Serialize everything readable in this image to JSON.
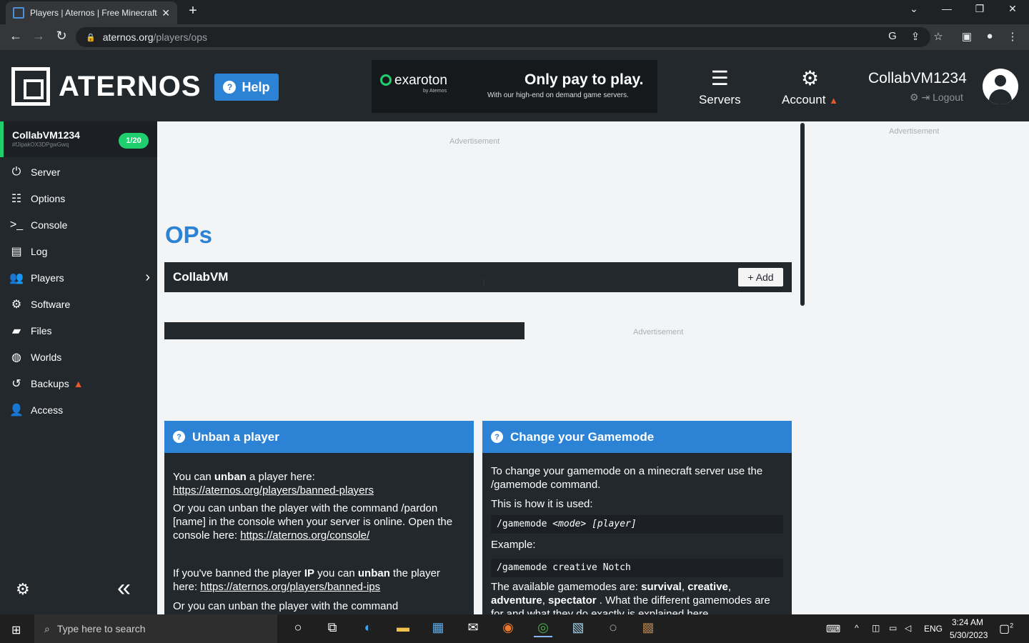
{
  "browser": {
    "tab_title": "Players | Aternos | Free Minecraft",
    "close_glyph": "✕",
    "new_tab_glyph": "+",
    "url_host": "aternos.org",
    "url_path": "/players/ops"
  },
  "header": {
    "logo_text": "ATERNOS",
    "help_label": "Help",
    "banner": {
      "brand": "exaroton",
      "brand_sub": "by Aternos",
      "headline": "Only pay to play.",
      "tagline": "With our high-end on demand game servers."
    },
    "nav": {
      "servers_label": "Servers",
      "account_label": "Account"
    },
    "user": {
      "name": "CollabVM1234",
      "logout_label": "Logout"
    }
  },
  "sidebar": {
    "server_name": "CollabVM1234",
    "server_id": "#fJipakOX3DPgwGwq",
    "player_count": "1/20",
    "items": [
      {
        "label": "Server",
        "icon": "power-icon"
      },
      {
        "label": "Options",
        "icon": "sliders-icon"
      },
      {
        "label": "Console",
        "icon": "terminal-icon"
      },
      {
        "label": "Log",
        "icon": "file-icon"
      },
      {
        "label": "Players",
        "icon": "users-icon"
      },
      {
        "label": "Software",
        "icon": "gears-icon"
      },
      {
        "label": "Files",
        "icon": "folder-icon"
      },
      {
        "label": "Worlds",
        "icon": "globe-icon"
      },
      {
        "label": "Backups",
        "icon": "history-icon"
      },
      {
        "label": "Access",
        "icon": "user-lock-icon"
      }
    ]
  },
  "main": {
    "ad_label": "Advertisement",
    "title": "OPs",
    "ops_input_value": "CollabVM",
    "add_label": "Add",
    "cards": {
      "unban": {
        "title": "Unban a player",
        "p1_a": "You can ",
        "p1_b": "unban",
        "p1_c": " a player here: ",
        "p1_link": "https://aternos.org/players/banned-players",
        "p2": "Or you can unban the player with the command /pardon [name] in the console when your server is online. Open the console here: ",
        "p2_link": "https://aternos.org/console/",
        "p3_a": "If you've banned the player ",
        "p3_b": "IP",
        "p3_c": " you can ",
        "p3_d": "unban",
        "p3_e": " the player here: ",
        "p3_link": "https://aternos.org/players/banned-ips",
        "p4": "Or you can unban the player with the command"
      },
      "gamemode": {
        "title": "Change your Gamemode",
        "p1": "To change your gamemode on a minecraft server use the /gamemode command.",
        "p2": "This is how it is used:",
        "code1_cmd": "/gamemode ",
        "code1_mode": "<mode>",
        "code1_player": " [player]",
        "p3": "Example:",
        "code2": "/gamemode creative Notch",
        "p4_a": "The available gamemodes are: ",
        "m1": "survival",
        "m2": "creative",
        "m3": "adventure",
        "m4": "spectator",
        "p4_b": " . What the different gamemodes are for and what they do exactly is explained here"
      }
    }
  },
  "taskbar": {
    "search_placeholder": "Type here to search",
    "lang": "ENG",
    "time": "3:24 AM",
    "date": "5/30/2023",
    "notif_count": "2"
  },
  "colors": {
    "accent": "#2c83d6",
    "dark": "#23282d",
    "online": "#1fcf6e",
    "warning": "#e8562a"
  }
}
